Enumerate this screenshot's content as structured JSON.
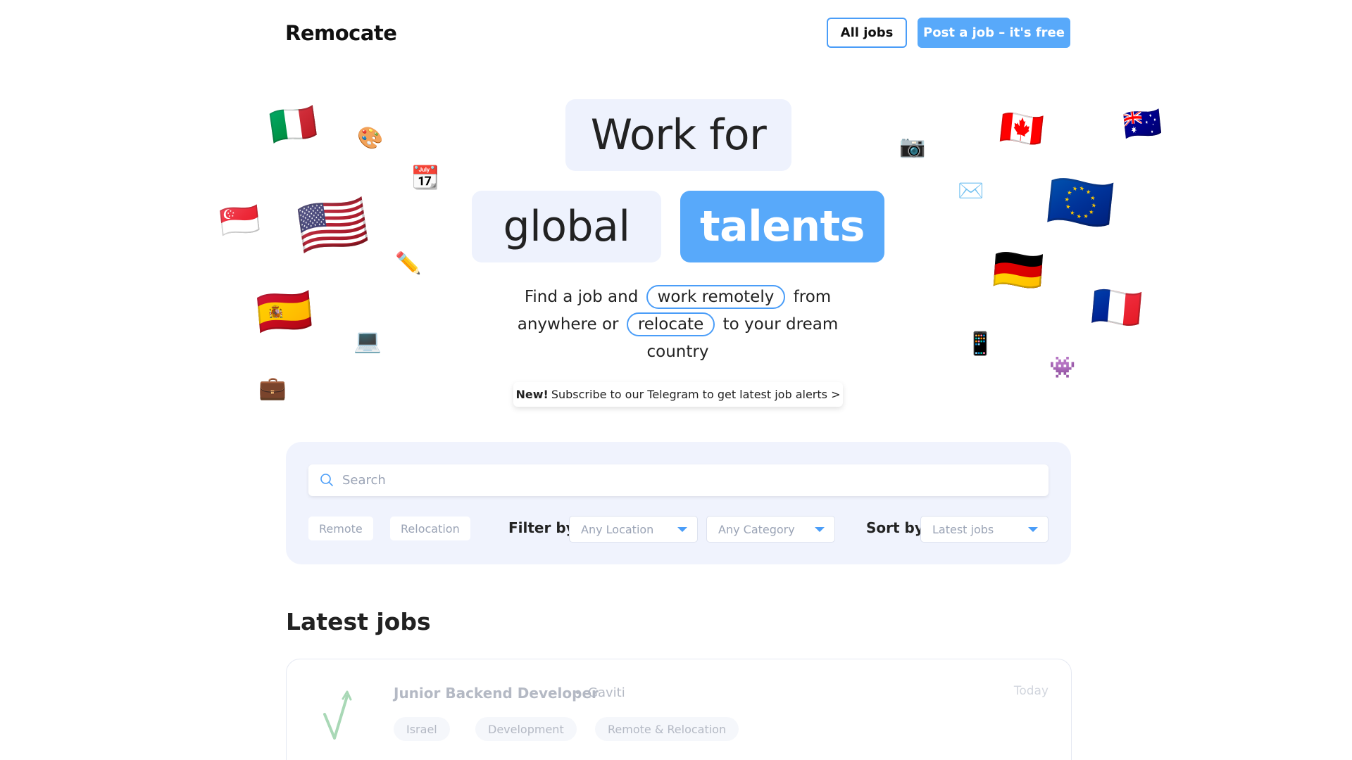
{
  "header": {
    "logo": "Remocate",
    "all_jobs_label": "All jobs",
    "post_job_label": "Post a job – it's free"
  },
  "hero": {
    "line1": "Work for",
    "line2a": "global",
    "line2b": "talents",
    "sub_part1": "Find a job and",
    "sub_chip1": "work remotely",
    "sub_part2": "from anywhere or",
    "sub_chip2": "relocate",
    "sub_part3": "to your dream country",
    "telegram_new": "New!",
    "telegram_text": "Subscribe to our Telegram to get latest job alerts >"
  },
  "emojis": {
    "italy": "🇮🇹",
    "palette": "🎨",
    "calendar": "📆",
    "singapore": "🇸🇬",
    "usa": "🇺🇸",
    "pencil": "✏️",
    "spain": "🇪🇸",
    "laptop": "💻",
    "briefcase": "💼",
    "camera": "📷",
    "envelope": "✉️",
    "canada": "🇨🇦",
    "eu": "🇪🇺",
    "australia": "🇦🇺",
    "germany": "🇩🇪",
    "france": "🇫🇷",
    "phone": "📱",
    "alien": "👾"
  },
  "search": {
    "placeholder": "Search"
  },
  "filters": {
    "remote_label": "Remote",
    "relocation_label": "Relocation",
    "filter_by_label": "Filter by",
    "location_value": "Any Location",
    "category_value": "Any Category",
    "sort_by_label": "Sort by",
    "sort_value": "Latest jobs"
  },
  "colors": {
    "accent": "#58a9fa",
    "panel_bg": "#f0f3fd"
  },
  "latest": {
    "title": "Latest jobs",
    "jobs": [
      {
        "title": "Junior Backend Developer",
        "separator": "•",
        "company": "Gaviti",
        "date": "Today",
        "tags": [
          "Israel",
          "Development",
          "Remote & Relocation"
        ]
      }
    ]
  }
}
